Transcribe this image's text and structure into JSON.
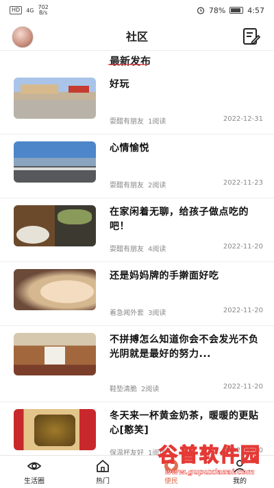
{
  "status_bar": {
    "network_badge": "HD",
    "signal": "4G",
    "speed_value": "702",
    "speed_unit": "B/s",
    "battery": "78%",
    "time": "4:57"
  },
  "header": {
    "title": "社区"
  },
  "feed": {
    "section_title": "最新发布",
    "items": [
      {
        "title": "好玩",
        "author": "耍醋有朋友",
        "reads": "1阅读",
        "date": "2022-12-31"
      },
      {
        "title": "心情愉悦",
        "author": "耍醋有朋友",
        "reads": "2阅读",
        "date": "2022-11-23"
      },
      {
        "title": "在家闲着无聊，给孩子做点吃的吧！",
        "author": "耍醋有朋友",
        "reads": "4阅读",
        "date": "2022-11-20"
      },
      {
        "title": "还是妈妈牌的手擀面好吃",
        "author": "着急闻外套",
        "reads": "3阅读",
        "date": "2022-11-20"
      },
      {
        "title": "不拼搏怎么知道你会不会发光不负光阴就是最好的努力...",
        "author": "鞋垫清脆",
        "reads": "2阅读",
        "date": "2022-11-20"
      },
      {
        "title": "冬天来一杯黄金奶茶，暖暖的更贴心[憨笑]",
        "author": "保温杯友好",
        "reads": "1阅读",
        "date": "2022-11-20"
      }
    ]
  },
  "tabbar": {
    "tabs": [
      {
        "label": "生活圈",
        "icon": "eye-icon"
      },
      {
        "label": "热门",
        "icon": "home-icon"
      },
      {
        "label": "便民",
        "icon": "heart-icon"
      },
      {
        "label": "我的",
        "icon": "user-icon"
      }
    ]
  },
  "watermark": {
    "text": "谷普软件园",
    "url": "www.gupuxlazai.com"
  },
  "colors": {
    "accent": "#e07050",
    "watermark_red": "#e53935",
    "text_primary": "#111111",
    "text_meta": "#888888"
  }
}
